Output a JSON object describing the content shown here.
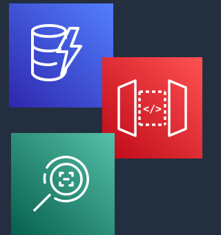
{
  "icons": {
    "dynamodb": {
      "icon": "database-lightning-icon",
      "gradient": [
        "#2e27ad",
        "#527fff"
      ]
    },
    "api_gateway": {
      "icon": "api-gateway-icon",
      "gradient": [
        "#bd0816",
        "#ff5252"
      ],
      "glyph": "</>"
    },
    "rekognition": {
      "icon": "magnifier-scan-icon",
      "gradient": [
        "#055f4e",
        "#56c0a7"
      ]
    }
  },
  "background_color": "#232f3e",
  "foreground_color": "#ffffff"
}
